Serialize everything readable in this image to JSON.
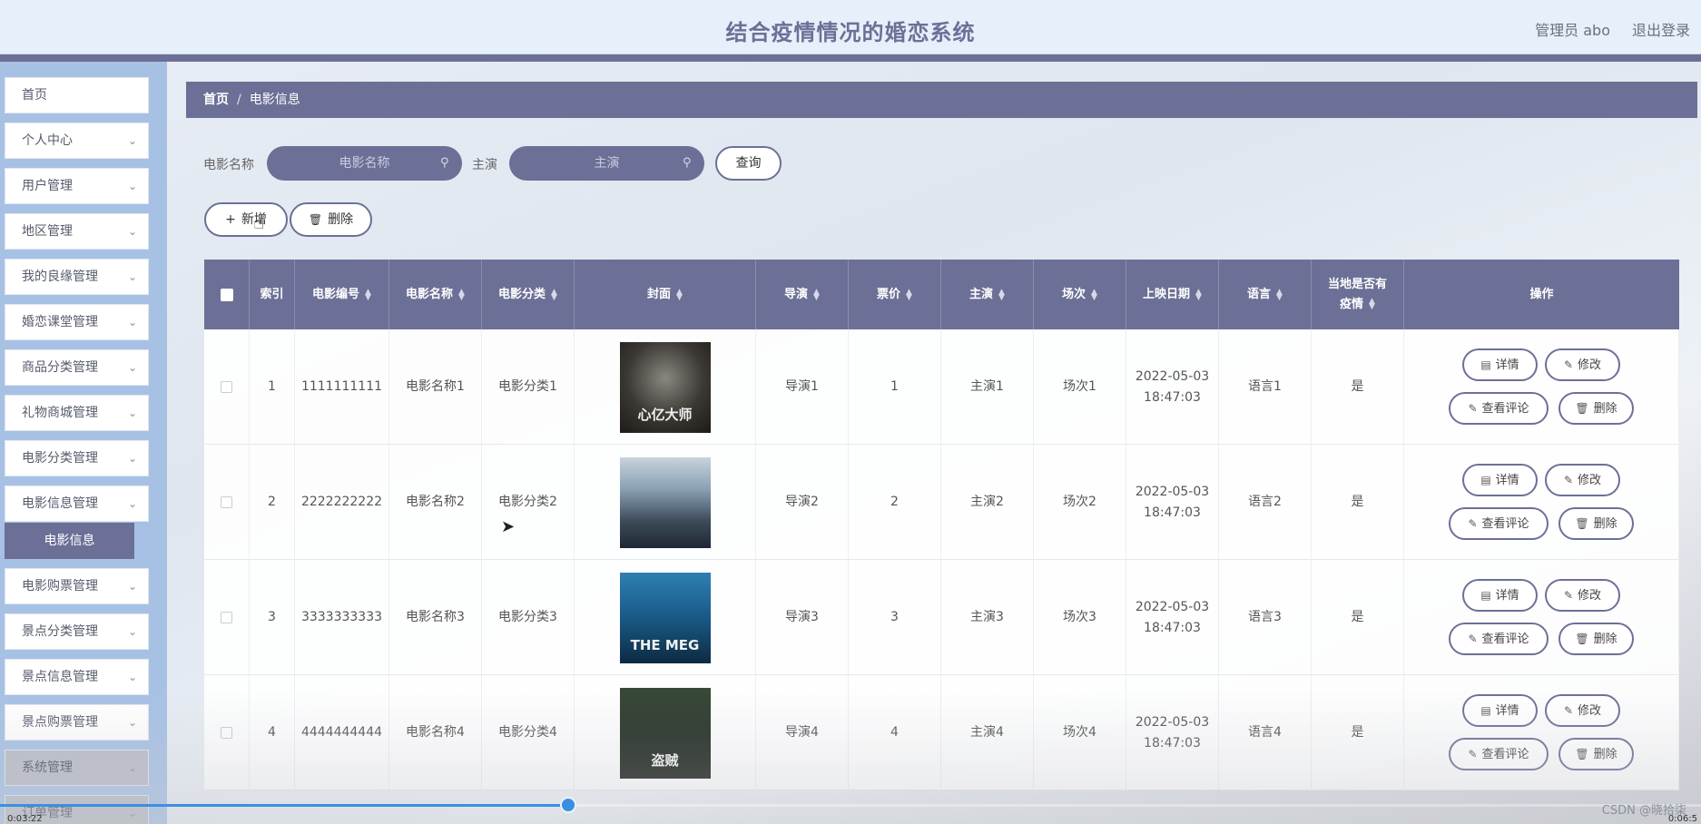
{
  "header": {
    "title": "结合疫情情况的婚恋系统",
    "admin_label": "管理员 abo",
    "logout_label": "退出登录"
  },
  "sidebar": {
    "items": [
      {
        "label": "首页",
        "has_chevron": false
      },
      {
        "label": "个人中心",
        "has_chevron": true
      },
      {
        "label": "用户管理",
        "has_chevron": true
      },
      {
        "label": "地区管理",
        "has_chevron": true
      },
      {
        "label": "我的良缘管理",
        "has_chevron": true
      },
      {
        "label": "婚恋课堂管理",
        "has_chevron": true
      },
      {
        "label": "商品分类管理",
        "has_chevron": true
      },
      {
        "label": "礼物商城管理",
        "has_chevron": true
      },
      {
        "label": "电影分类管理",
        "has_chevron": true
      },
      {
        "label": "电影信息管理",
        "has_chevron": true
      },
      {
        "label": "电影购票管理",
        "has_chevron": true
      },
      {
        "label": "景点分类管理",
        "has_chevron": true
      },
      {
        "label": "景点信息管理",
        "has_chevron": true
      },
      {
        "label": "景点购票管理",
        "has_chevron": true
      },
      {
        "label": "系统管理",
        "has_chevron": true
      },
      {
        "label": "订单管理",
        "has_chevron": true
      }
    ],
    "active_sub": "电影信息"
  },
  "breadcrumb": {
    "home": "首页",
    "separator": "/",
    "current": "电影信息"
  },
  "search": {
    "name_label": "电影名称",
    "name_placeholder": "电影名称",
    "actor_label": "主演",
    "actor_placeholder": "主演",
    "query_button": "查询"
  },
  "toolbar": {
    "add_label": "新增",
    "delete_label": "删除"
  },
  "table": {
    "columns": [
      "索引",
      "电影编号",
      "电影名称",
      "电影分类",
      "封面",
      "导演",
      "票价",
      "主演",
      "场次",
      "上映日期",
      "语言",
      "当地是否有",
      "疫情",
      "操作"
    ],
    "rows": [
      {
        "index": "1",
        "code": "1111111111",
        "name": "电影名称1",
        "category": "电影分类1",
        "director": "导演1",
        "price": "1",
        "actor": "主演1",
        "session": "场次1",
        "date": "2022-05-03",
        "time": "18:47:03",
        "language": "语言1",
        "epidemic": "是",
        "cover_text": "心亿大师"
      },
      {
        "index": "2",
        "code": "2222222222",
        "name": "电影名称2",
        "category": "电影分类2",
        "director": "导演2",
        "price": "2",
        "actor": "主演2",
        "session": "场次2",
        "date": "2022-05-03",
        "time": "18:47:03",
        "language": "语言2",
        "epidemic": "是",
        "cover_text": ""
      },
      {
        "index": "3",
        "code": "3333333333",
        "name": "电影名称3",
        "category": "电影分类3",
        "director": "导演3",
        "price": "3",
        "actor": "主演3",
        "session": "场次3",
        "date": "2022-05-03",
        "time": "18:47:03",
        "language": "语言3",
        "epidemic": "是",
        "cover_text": "THE MEG"
      },
      {
        "index": "4",
        "code": "4444444444",
        "name": "电影名称4",
        "category": "电影分类4",
        "director": "导演4",
        "price": "4",
        "actor": "主演4",
        "session": "场次4",
        "date": "2022-05-03",
        "time": "18:47:03",
        "language": "语言4",
        "epidemic": "是",
        "cover_text": "盗贼"
      }
    ],
    "actions": {
      "detail": "详情",
      "edit": "修改",
      "comments": "查看评论",
      "delete": "删除"
    }
  },
  "video": {
    "elapsed": "0:03:22",
    "total": "0:06:5",
    "progress": 0.334
  },
  "watermark": "CSDN @晓拾柒",
  "colors": {
    "accent": "#6c7096",
    "header_bg": "#e6f0fa",
    "sidebar_bg": "#a7c1e5",
    "progress": "#3c8fe0"
  }
}
